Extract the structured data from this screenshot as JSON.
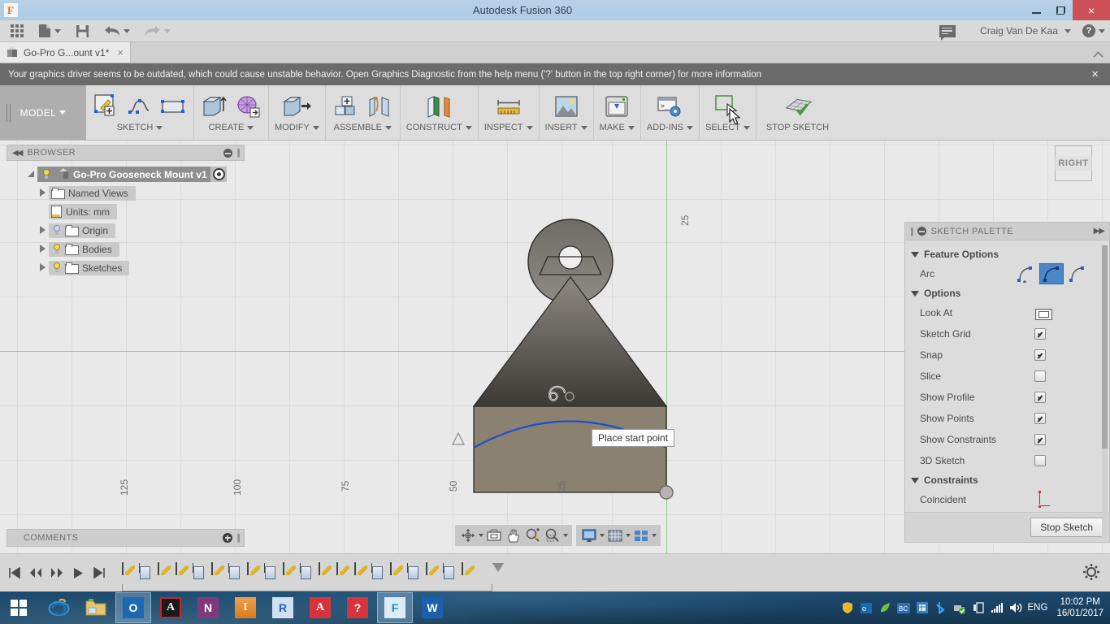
{
  "window": {
    "app_icon": "fusion-logo-icon",
    "title": "Autodesk Fusion 360",
    "minimize": "minimize-icon",
    "restore": "restore-icon",
    "close": "×"
  },
  "quick_access": {
    "items": [
      {
        "name": "app-grid",
        "icon": "grid-9-icon",
        "has_caret": false
      },
      {
        "name": "new-file",
        "icon": "file-icon",
        "has_caret": true
      },
      {
        "name": "save",
        "icon": "save-floppy-icon",
        "has_caret": false
      },
      {
        "name": "undo",
        "icon": "undo-arrow-icon",
        "has_caret": true
      },
      {
        "name": "redo",
        "icon": "redo-arrow-icon",
        "has_caret": true
      }
    ],
    "chat_icon": "chat-bubble-icon",
    "user_name": "Craig Van De Kaa",
    "help_label": "?"
  },
  "document_tab": {
    "icon": "cube-icon",
    "label": "Go-Pro G...ount v1*",
    "close": "×",
    "collapse_icon": "chevron-up-icon"
  },
  "warning": {
    "text": "Your graphics driver seems to be outdated, which could cause unstable behavior. Open Graphics Diagnostic from the help menu ('?' button in the top right corner) for more information",
    "close": "×"
  },
  "ribbon": {
    "workspace": "MODEL",
    "groups": [
      {
        "label": "SKETCH",
        "caret": true,
        "icons": [
          "create-sketch-icon",
          "spline-icon",
          "rectangle-icon"
        ]
      },
      {
        "label": "CREATE",
        "caret": true,
        "icons": [
          "extrude-icon",
          "mesh-insert-icon"
        ]
      },
      {
        "label": "MODIFY",
        "caret": true,
        "icons": [
          "press-pull-icon"
        ]
      },
      {
        "label": "ASSEMBLE",
        "caret": true,
        "icons": [
          "new-component-icon",
          "joint-icon"
        ]
      },
      {
        "label": "CONSTRUCT",
        "caret": true,
        "icons": [
          "offset-plane-icon"
        ]
      },
      {
        "label": "INSPECT",
        "caret": true,
        "icons": [
          "measure-ruler-icon"
        ]
      },
      {
        "label": "INSERT",
        "caret": true,
        "icons": [
          "insert-image-icon"
        ]
      },
      {
        "label": "MAKE",
        "caret": true,
        "icons": [
          "3d-print-icon"
        ]
      },
      {
        "label": "ADD-INS",
        "caret": true,
        "icons": [
          "scripts-addins-icon"
        ]
      },
      {
        "label": "SELECT",
        "caret": true,
        "icons": [
          "select-window-icon"
        ]
      },
      {
        "label": "STOP SKETCH",
        "caret": false,
        "icons": [
          "stop-sketch-icon"
        ]
      }
    ]
  },
  "browser": {
    "header": "BROWSER",
    "collapse_icon": "collapse-left-icon",
    "minus_icon": "minus-circle-icon",
    "grip_icon": "grip-icon",
    "root": {
      "label": "Go-Pro Gooseneck Mount v1",
      "bulb": "on",
      "target_icon": "activate-component-icon"
    },
    "items": [
      {
        "label": "Named Views",
        "icon": "folder-icon",
        "bulb": "none",
        "expandable": true
      },
      {
        "label": "Units: mm",
        "icon": "document-icon",
        "bulb": "none",
        "expandable": false
      },
      {
        "label": "Origin",
        "icon": "folder-icon",
        "bulb": "off",
        "expandable": true
      },
      {
        "label": "Bodies",
        "icon": "folder-icon",
        "bulb": "on",
        "expandable": true
      },
      {
        "label": "Sketches",
        "icon": "folder-icon",
        "bulb": "on",
        "expandable": true
      }
    ]
  },
  "comments": {
    "label": "COMMENTS",
    "add_icon": "plus-circle-icon",
    "grip_icon": "grip-icon"
  },
  "viewport": {
    "view_cube_label": "RIGHT",
    "tooltip": "Place start point",
    "cursor_icon": "arc-tool-cursor-icon",
    "constraint_icon": "tangent-constraint-icon",
    "axis_ticks": [
      "125",
      "100",
      "75",
      "50",
      "25"
    ],
    "y_axis_tick": "25",
    "colors": {
      "sketch_curve": "#1a4fd0",
      "x_axis": "#e2a0a0",
      "y_axis": "#8ec98e",
      "body_top": "#6a6560",
      "body_face": "#8b8170",
      "grid": "#dcdcdc",
      "background": "#e9e9e9"
    }
  },
  "sketch_palette": {
    "header": "SKETCH PALETTE",
    "minus_icon": "minus-circle-icon",
    "grip_icon": "grip-icon",
    "expand_icon": "expand-right-icon",
    "sections": [
      {
        "title": "Feature Options",
        "rows": [
          {
            "label": "Arc",
            "control": "arc-type-buttons",
            "selected_index": 1,
            "options": [
              "arc-3-point-icon",
              "arc-tangent-icon",
              "arc-center-point-icon"
            ]
          }
        ]
      },
      {
        "title": "Options",
        "rows": [
          {
            "label": "Look At",
            "control": "button",
            "icon": "look-at-icon"
          },
          {
            "label": "Sketch Grid",
            "control": "checkbox",
            "checked": true
          },
          {
            "label": "Snap",
            "control": "checkbox",
            "checked": true
          },
          {
            "label": "Slice",
            "control": "checkbox",
            "checked": false
          },
          {
            "label": "Show Profile",
            "control": "checkbox",
            "checked": true
          },
          {
            "label": "Show Points",
            "control": "checkbox",
            "checked": true
          },
          {
            "label": "Show Constraints",
            "control": "checkbox",
            "checked": true
          },
          {
            "label": "3D Sketch",
            "control": "checkbox",
            "checked": false
          }
        ]
      },
      {
        "title": "Constraints",
        "rows": [
          {
            "label": "Coincident",
            "control": "button",
            "icon": "coincident-constraint-icon"
          }
        ]
      }
    ],
    "footer_button": "Stop Sketch"
  },
  "nav_bar": {
    "groups": [
      [
        {
          "icon": "orbit-icon",
          "caret": true
        },
        {
          "icon": "look-at-icon",
          "caret": false
        },
        {
          "icon": "pan-hand-icon",
          "caret": false
        },
        {
          "icon": "zoom-icon",
          "caret": false
        },
        {
          "icon": "zoom-window-icon",
          "caret": true
        }
      ],
      [
        {
          "icon": "display-settings-icon",
          "caret": true
        },
        {
          "icon": "grid-snaps-icon",
          "caret": true
        },
        {
          "icon": "viewports-icon",
          "caret": true
        }
      ]
    ]
  },
  "timeline": {
    "playback": [
      "jump-start-icon",
      "step-back-icon",
      "step-forward-icon",
      "play-icon",
      "jump-end-icon"
    ],
    "features": [
      "sketch",
      "extrude",
      "sketch",
      "sketch",
      "extrude",
      "sketch",
      "extrude",
      "sketch",
      "extrude",
      "sketch",
      "extrude",
      "sketch",
      "sketch",
      "sketch",
      "extrude",
      "sketch",
      "extrude",
      "sketch",
      "extrude",
      "sketch"
    ],
    "settings_icon": "gear-icon"
  },
  "taskbar": {
    "start_icon": "windows-start-icon",
    "apps": [
      {
        "name": "internet-explorer",
        "glyph": "e",
        "bg": "#1576c0",
        "fg": "#ffffff",
        "active": false
      },
      {
        "name": "file-explorer",
        "glyph": "",
        "bg": "#e8c878",
        "fg": "#6b4f17",
        "active": false
      },
      {
        "name": "outlook",
        "glyph": "O",
        "bg": "#1b69b0",
        "fg": "#ffffff",
        "active": true
      },
      {
        "name": "adobe-acrobat",
        "glyph": "A",
        "bg": "#c1272d",
        "fg": "#ffffff",
        "active": false
      },
      {
        "name": "onenote",
        "glyph": "N",
        "bg": "#80397b",
        "fg": "#ffffff",
        "active": false
      },
      {
        "name": "inventor-pro",
        "glyph": "I",
        "bg": "#e08b3c",
        "fg": "#ffffff",
        "active": false
      },
      {
        "name": "revit",
        "glyph": "R",
        "bg": "#2a6fc0",
        "fg": "#ffffff",
        "active": false
      },
      {
        "name": "autocad",
        "glyph": "A",
        "bg": "#d6343c",
        "fg": "#ffffff",
        "active": false
      },
      {
        "name": "sketchup",
        "glyph": "?",
        "bg": "#d6343c",
        "fg": "#ffffff",
        "active": false
      },
      {
        "name": "fusion-360",
        "glyph": "F",
        "bg": "#cfe4f2",
        "fg": "#2b7fbf",
        "active": true
      },
      {
        "name": "word",
        "glyph": "W",
        "bg": "#1b5fb0",
        "fg": "#ffffff",
        "active": false
      }
    ],
    "tray": [
      "shield-icon",
      "outlook-tray-icon",
      "leaf-icon",
      "bc-icon",
      "excel-tray-icon",
      "bluetooth-icon",
      "usb-eject-icon",
      "display-icon",
      "network-signal-icon",
      "volume-icon"
    ],
    "language": "ENG",
    "time": "10:02 PM",
    "date": "16/01/2017"
  }
}
